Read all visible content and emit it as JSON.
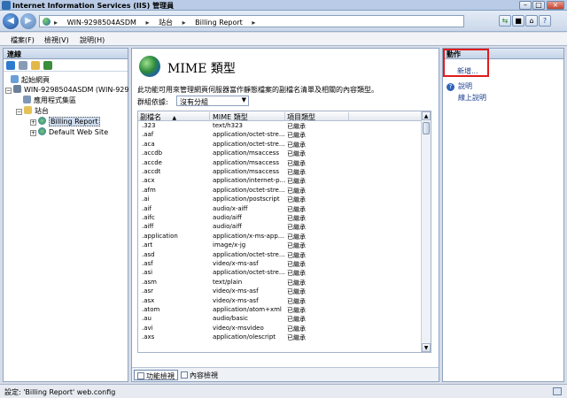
{
  "window": {
    "title": "Internet Information Services (IIS) 管理員"
  },
  "address": {
    "crumbs": [
      "WIN-9298504ASDM",
      "站台",
      "Billing Report"
    ]
  },
  "menu": [
    "檔案(F)",
    "檢視(V)",
    "說明(H)"
  ],
  "connections": {
    "header": "連線",
    "tree": [
      {
        "label": "起始網頁",
        "level": 0,
        "icon": "home"
      },
      {
        "label": "WIN-9298504ASDM (WIN-929",
        "level": 0,
        "icon": "server",
        "expanded": true
      },
      {
        "label": "應用程式集區",
        "level": 1,
        "icon": "pool"
      },
      {
        "label": "站台",
        "level": 1,
        "icon": "folder",
        "expanded": true
      },
      {
        "label": "Billing Report",
        "level": 2,
        "icon": "globe",
        "selected": true
      },
      {
        "label": "Default Web Site",
        "level": 2,
        "icon": "globe"
      }
    ]
  },
  "feature": {
    "title": "MIME 類型",
    "description": "此功能可用來管理網頁伺服器當作靜態檔案的副檔名清單及相關的內容類型。",
    "group_label": "群組依據:",
    "group_value": "沒有分組",
    "columns": [
      "副檔名",
      "MIME 類型",
      "項目類型"
    ],
    "rows": [
      [
        ".323",
        "text/h323",
        "已繼承"
      ],
      [
        ".aaf",
        "application/octet-stre...",
        "已繼承"
      ],
      [
        ".aca",
        "application/octet-stre...",
        "已繼承"
      ],
      [
        ".accdb",
        "application/msaccess",
        "已繼承"
      ],
      [
        ".accde",
        "application/msaccess",
        "已繼承"
      ],
      [
        ".accdt",
        "application/msaccess",
        "已繼承"
      ],
      [
        ".acx",
        "application/internet-p...",
        "已繼承"
      ],
      [
        ".afm",
        "application/octet-stre...",
        "已繼承"
      ],
      [
        ".ai",
        "application/postscript",
        "已繼承"
      ],
      [
        ".aif",
        "audio/x-aiff",
        "已繼承"
      ],
      [
        ".aifc",
        "audio/aiff",
        "已繼承"
      ],
      [
        ".aiff",
        "audio/aiff",
        "已繼承"
      ],
      [
        ".application",
        "application/x-ms-app...",
        "已繼承"
      ],
      [
        ".art",
        "image/x-jg",
        "已繼承"
      ],
      [
        ".asd",
        "application/octet-stre...",
        "已繼承"
      ],
      [
        ".asf",
        "video/x-ms-asf",
        "已繼承"
      ],
      [
        ".asi",
        "application/octet-stre...",
        "已繼承"
      ],
      [
        ".asm",
        "text/plain",
        "已繼承"
      ],
      [
        ".asr",
        "video/x-ms-asf",
        "已繼承"
      ],
      [
        ".asx",
        "video/x-ms-asf",
        "已繼承"
      ],
      [
        ".atom",
        "application/atom+xml",
        "已繼承"
      ],
      [
        ".au",
        "audio/basic",
        "已繼承"
      ],
      [
        ".avi",
        "video/x-msvideo",
        "已繼承"
      ],
      [
        ".axs",
        "application/olescript",
        "已繼承"
      ]
    ],
    "view_tabs": [
      "功能檢視",
      "內容檢視"
    ]
  },
  "actions": {
    "header": "動作",
    "add": "新增...",
    "help": "說明",
    "online_help": "線上說明"
  },
  "status": {
    "text": "設定: 'Billing Report' web.config"
  }
}
